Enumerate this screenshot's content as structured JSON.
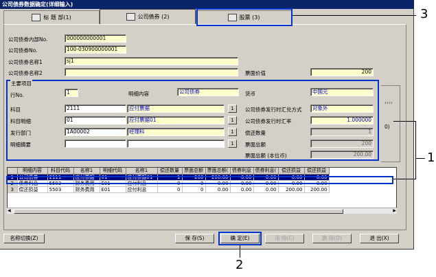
{
  "window": {
    "title": "公司债券数据确定(详细输入)"
  },
  "tabs": [
    {
      "label": "标 题 部(1)"
    },
    {
      "label": "公司债券 (2)"
    },
    {
      "label": "股票 (3)"
    }
  ],
  "header": {
    "internal_no_label": "公司债券内部No.",
    "internal_no_value": "000000000001",
    "bond_no_label": "公司债券No.",
    "bond_no_value": "100-030900000001",
    "name1_label": "公司债券名称1",
    "name1_value": "sj1",
    "name2_label": "公司债券名称2",
    "name2_value": "",
    "face_value_label": "票面价值",
    "face_value_value": "200"
  },
  "main_group": {
    "title": "主要项目",
    "row_no_label": "行No.",
    "row_no_value": "1",
    "detail_content_label": "明细内容",
    "detail_content_value": "公司债券",
    "currency_label": "货币",
    "currency_value": "中国元",
    "account_label": "科目",
    "account_code": "2111",
    "account_name": "应付票据",
    "account_detail_label": "科目明细",
    "account_detail_code": "01",
    "account_detail_name": "应付票据01",
    "dept_label": "发行部门",
    "dept_code": "1A00002",
    "dept_name": "经理科",
    "summary_label": "明细摘要",
    "summary_value": "",
    "rate_method_label": "公司债券发行时汇兑方式",
    "rate_method_value": "对象外",
    "rate_label": "公司债券发行时汇率",
    "rate_value": "1.000000",
    "repay_qty_label": "偿还数量",
    "repay_qty_value": "1",
    "face_total_label": "票面总额",
    "face_total_value": "200",
    "face_total_local_label": "票面总额 (本位币)",
    "face_total_local_value": "200.00",
    "mini_btn": "1"
  },
  "grid": {
    "columns": [
      "明细内容",
      "科目代码",
      "名称1",
      "明细代码",
      "名称1",
      "偿还数量",
      "票面总额",
      "票面总额(",
      "债券利息",
      "债券利息(",
      "偿还损益",
      "偿还损益"
    ],
    "rows": [
      {
        "rn": "1",
        "cells": [
          "公司债券",
          "2111",
          "应付票据",
          "01",
          "应付票据01",
          "1",
          "200",
          "200.00",
          "0.00",
          "0.00",
          "0.00",
          "0.00"
        ]
      },
      {
        "rn": "2",
        "cells": [
          "债券利息",
          "5503",
          "财务费用",
          "E01",
          "应付利息",
          "0",
          "0",
          "0.00",
          "0.00",
          "0.00",
          "0.00",
          "0.00"
        ]
      },
      {
        "rn": "3",
        "cells": [
          "偿还损益",
          "5503",
          "财务费用",
          "E01",
          "应付利息",
          "0",
          "0",
          "0.00",
          "0.00",
          "0.00",
          "200.00",
          "200.00"
        ]
      }
    ]
  },
  "side_text": "0)",
  "buttons": {
    "name_switch": "名称切换(Z)",
    "save": "保 存(S)",
    "confirm": "确 定(E)",
    "clear": "清 除(C)",
    "delete": "删 除(D)",
    "exit": "退 出(X)"
  },
  "callouts": [
    "1",
    "2",
    "3"
  ]
}
